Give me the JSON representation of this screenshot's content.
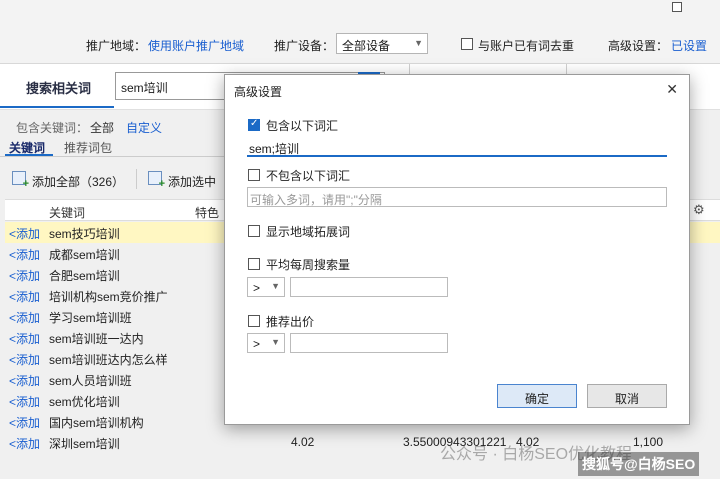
{
  "top": {
    "region_label": "推广地域：",
    "region_link": "使用账户推广地域",
    "device_label": "推广设备：",
    "device_value": "全部设备",
    "dedupe_label": "与账户已有词去重",
    "advanced_label": "高级设置：",
    "advanced_link": "已设置"
  },
  "search": {
    "title": "搜索相关词",
    "value": "sem培训"
  },
  "filter": {
    "include_label": "包含关键词：",
    "include_all": "全部",
    "include_custom": "自定义"
  },
  "tabs": [
    "关键词",
    "推荐词包"
  ],
  "actions": {
    "add_all": "添加全部（326）",
    "add_selected": "添加选中"
  },
  "table": {
    "headers": [
      "关键词",
      "特色"
    ],
    "add_label": "<添加",
    "rows": [
      {
        "keyword": "sem技巧培训",
        "highlight": true
      },
      {
        "keyword": "成都sem培训"
      },
      {
        "keyword": "合肥sem培训"
      },
      {
        "keyword": "培训机构sem竞价推广"
      },
      {
        "keyword": "学习sem培训班"
      },
      {
        "keyword": "sem培训班一达内"
      },
      {
        "keyword": "sem培训班达内怎么样"
      },
      {
        "keyword": "sem人员培训班"
      },
      {
        "keyword": "sem优化培训"
      },
      {
        "keyword": "国内sem培训机构"
      },
      {
        "keyword": "深圳sem培训",
        "c1": "4.02",
        "c2": "3.55000943301221",
        "c3": "4.02",
        "c4": "1,100"
      }
    ]
  },
  "dialog": {
    "title": "高级设置",
    "close": "✕",
    "include_label": "包含以下词汇",
    "include_value": "sem;培训",
    "exclude_label": "不包含以下词汇",
    "exclude_placeholder": "可输入多词，请用\";\"分隔",
    "region_expand_label": "显示地域拓展词",
    "weekly_label": "平均每周搜索量",
    "bid_label": "推荐出价",
    "operator": ">",
    "ok": "确定",
    "cancel": "取消"
  },
  "watermark": {
    "text": "公众号 · 白杨SEO优化教程",
    "badge": "搜狐号@白杨SEO"
  },
  "colors": {
    "accent": "#1b6ac6",
    "link": "#1a5fd0",
    "highlight_row": "#fff7c2"
  }
}
